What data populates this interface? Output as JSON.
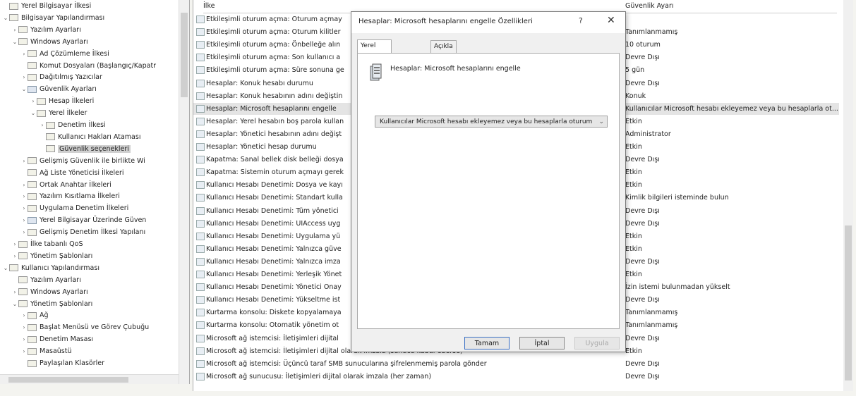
{
  "tree": [
    {
      "label": "Yerel Bilgisayar İlkesi",
      "indent": 0,
      "exp": "",
      "icon": "computer-icon"
    },
    {
      "label": "Bilgisayar Yapılandırması",
      "indent": 0,
      "exp": "⌄",
      "icon": "computer-config-icon"
    },
    {
      "label": "Yazılım Ayarları",
      "indent": 1,
      "exp": "›",
      "icon": "folder-icon"
    },
    {
      "label": "Windows Ayarları",
      "indent": 1,
      "exp": "⌄",
      "icon": "folder-icon"
    },
    {
      "label": "Ad Çözümleme İlkesi",
      "indent": 2,
      "exp": "›",
      "icon": "folder-icon"
    },
    {
      "label": "Komut Dosyaları (Başlangıç/Kapatr",
      "indent": 2,
      "exp": "",
      "icon": "script-icon"
    },
    {
      "label": "Dağıtılmış Yazıcılar",
      "indent": 2,
      "exp": "›",
      "icon": "printer-icon"
    },
    {
      "label": "Güvenlik Ayarları",
      "indent": 2,
      "exp": "⌄",
      "icon": "security-icon"
    },
    {
      "label": "Hesap İlkeleri",
      "indent": 3,
      "exp": "›",
      "icon": "folder-icon"
    },
    {
      "label": "Yerel İlkeler",
      "indent": 3,
      "exp": "⌄",
      "icon": "folder-icon"
    },
    {
      "label": "Denetim İlkesi",
      "indent": 4,
      "exp": "›",
      "icon": "folder-icon"
    },
    {
      "label": "Kullanıcı Hakları Ataması",
      "indent": 4,
      "exp": "",
      "icon": "folder-icon"
    },
    {
      "label": "Güvenlik seçenekleri",
      "indent": 4,
      "exp": "",
      "icon": "folder-icon",
      "selected": true
    },
    {
      "label": "Gelişmiş Güvenlik ile birlikte Wi",
      "indent": 2,
      "exp": "›",
      "icon": "folder-icon"
    },
    {
      "label": "Ağ Liste Yöneticisi İlkeleri",
      "indent": 2,
      "exp": "",
      "icon": "folder-icon"
    },
    {
      "label": "Ortak Anahtar İlkeleri",
      "indent": 2,
      "exp": "›",
      "icon": "folder-icon"
    },
    {
      "label": "Yazılım Kısıtlama İlkeleri",
      "indent": 2,
      "exp": "›",
      "icon": "folder-icon"
    },
    {
      "label": "Uygulama Denetim İlkeleri",
      "indent": 2,
      "exp": "›",
      "icon": "folder-icon"
    },
    {
      "label": "Yerel Bilgisayar Üzerinde Güven",
      "indent": 2,
      "exp": "›",
      "icon": "shield-icon"
    },
    {
      "label": "Gelişmiş Denetim İlkesi Yapılanı",
      "indent": 2,
      "exp": "›",
      "icon": "folder-icon"
    },
    {
      "label": "İlke tabanlı QoS",
      "indent": 1,
      "exp": "›",
      "icon": "chart-icon"
    },
    {
      "label": "Yönetim Şablonları",
      "indent": 1,
      "exp": "›",
      "icon": "folder-icon"
    },
    {
      "label": "Kullanıcı Yapılandırması",
      "indent": 0,
      "exp": "⌄",
      "icon": "user-config-icon"
    },
    {
      "label": "Yazılım Ayarları",
      "indent": 1,
      "exp": "",
      "icon": "folder-icon"
    },
    {
      "label": "Windows Ayarları",
      "indent": 1,
      "exp": "›",
      "icon": "folder-icon"
    },
    {
      "label": "Yönetim Şablonları",
      "indent": 1,
      "exp": "⌄",
      "icon": "folder-icon"
    },
    {
      "label": "Ağ",
      "indent": 2,
      "exp": "›",
      "icon": "folder-icon"
    },
    {
      "label": "Başlat Menüsü ve Görev Çubuğu",
      "indent": 2,
      "exp": "›",
      "icon": "folder-icon"
    },
    {
      "label": "Denetim Masası",
      "indent": 2,
      "exp": "›",
      "icon": "folder-icon"
    },
    {
      "label": "Masaüstü",
      "indent": 2,
      "exp": "›",
      "icon": "folder-icon"
    },
    {
      "label": "Paylaşılan Klasörler",
      "indent": 2,
      "exp": "",
      "icon": "folder-icon"
    }
  ],
  "list": {
    "col_policy": "İlke",
    "col_setting": "Güvenlik Ayarı",
    "rows": [
      {
        "policy": "Etkileşimli oturum açma: Oturum açmay",
        "setting": ""
      },
      {
        "policy": "Etkileşimli oturum açma: Oturum kilitler",
        "setting": "Tanımlanmamış"
      },
      {
        "policy": "Etkileşimli oturum açma: Önbelleğe alın",
        "setting": "10 oturum"
      },
      {
        "policy": "Etkileşimli oturum açma: Son kullanıcı a",
        "setting": "Devre Dışı"
      },
      {
        "policy": "Etkileşimli oturum açma: Süre sonuna ge",
        "setting": "5 gün"
      },
      {
        "policy": "Hesaplar: Konuk hesabı durumu",
        "setting": "Devre Dışı"
      },
      {
        "policy": "Hesaplar: Konuk hesabının adını değiştin",
        "setting": "Konuk"
      },
      {
        "policy": "Hesaplar: Microsoft hesaplarını engelle",
        "setting": "Kullanıcılar Microsoft hesabı ekleyemez veya bu hesaplarla ot...",
        "sel": true
      },
      {
        "policy": "Hesaplar: Yerel hesabın boş parola kullan",
        "setting": "Etkin"
      },
      {
        "policy": "Hesaplar: Yönetici hesabının adını değişt",
        "setting": "Administrator"
      },
      {
        "policy": "Hesaplar: Yönetici hesap durumu",
        "setting": "Etkin"
      },
      {
        "policy": "Kapatma: Sanal bellek disk belleği dosya",
        "setting": "Devre Dışı"
      },
      {
        "policy": "Kapatma: Sistemin oturum açmayı gerek",
        "setting": "Etkin"
      },
      {
        "policy": "Kullanıcı Hesabı Denetimi: Dosya ve kayı",
        "setting": "Etkin"
      },
      {
        "policy": "Kullanıcı Hesabı Denetimi: Standart kulla",
        "setting": "Kimlik bilgileri isteminde bulun"
      },
      {
        "policy": "Kullanıcı Hesabı Denetimi: Tüm yönetici",
        "setting": "Devre Dışı"
      },
      {
        "policy": "Kullanıcı Hesabı Denetimi: UIAccess uyg",
        "setting": "Devre Dışı"
      },
      {
        "policy": "Kullanıcı Hesabı Denetimi: Uygulama yü",
        "setting": "Etkin"
      },
      {
        "policy": "Kullanıcı Hesabı Denetimi: Yalnızca güve",
        "setting": "Etkin"
      },
      {
        "policy": "Kullanıcı Hesabı Denetimi: Yalnızca imza",
        "setting": "Devre Dışı"
      },
      {
        "policy": "Kullanıcı Hesabı Denetimi: Yerleşik Yönet",
        "setting": "Etkin"
      },
      {
        "policy": "Kullanıcı Hesabı Denetimi: Yönetici Onay",
        "setting": "İzin istemi bulunmadan yükselt"
      },
      {
        "policy": "Kullanıcı Hesabı Denetimi: Yükseltme ist",
        "setting": "Devre Dışı"
      },
      {
        "policy": "Kurtarma konsolu: Diskete kopyalamaya",
        "setting": "Tanımlanmamış"
      },
      {
        "policy": "Kurtarma konsolu: Otomatik yönetim ot",
        "setting": "Tanımlanmamış"
      },
      {
        "policy": "Microsoft ağ istemcisi: İletişimleri dijital",
        "setting": "Devre Dışı"
      },
      {
        "policy": "Microsoft ağ istemcisi: İletişimleri dijital olarak imzala (sunucu kabul ederse)",
        "setting": "Etkin"
      },
      {
        "policy": "Microsoft ağ istemcisi: Üçüncü taraf SMB sunucularına şifrelenmemiş parola gönder",
        "setting": "Devre Dışı"
      },
      {
        "policy": "Microsoft ağ sunucusu: İletişimleri dijital olarak imzala (her zaman)",
        "setting": "Devre Dışı"
      }
    ]
  },
  "dialog": {
    "title": "Hesaplar: Microsoft hesaplarını engelle Özellikleri",
    "help": "?",
    "close": "✕",
    "tab_local": "Yerel Güvenlik Ayarı",
    "tab_explain": "Açıkla",
    "policy_title": "Hesaplar: Microsoft hesaplarını engelle",
    "dropdown_value": "Kullanıcılar Microsoft hesabı ekleyemez veya bu hesaplarla oturum",
    "btn_ok": "Tamam",
    "btn_cancel": "İptal",
    "btn_apply": "Uygula"
  }
}
